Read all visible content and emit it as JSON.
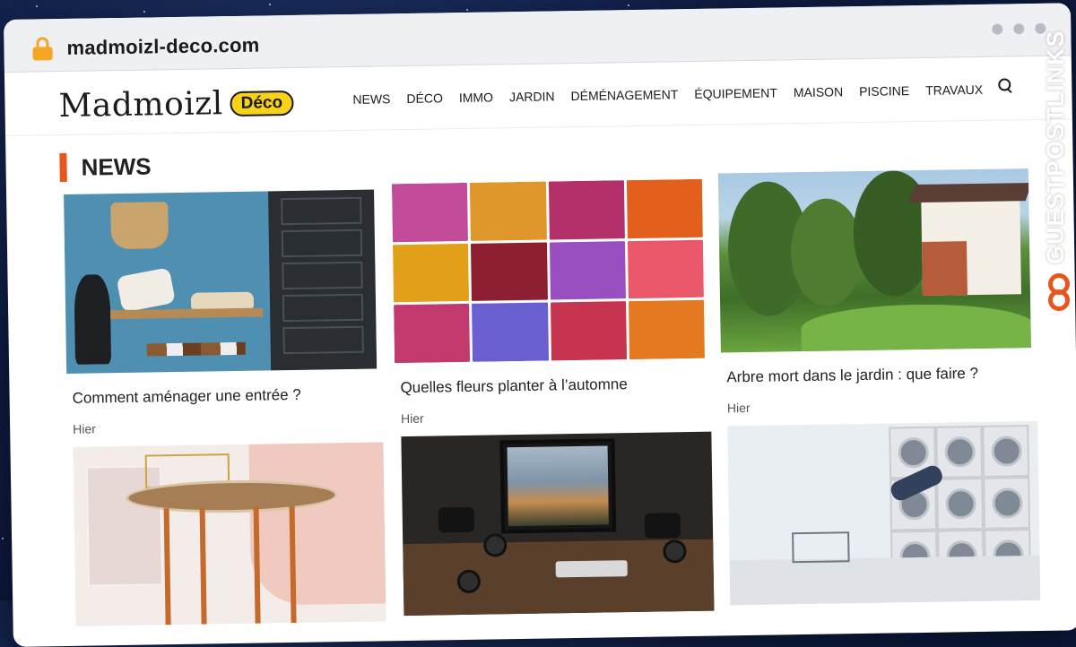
{
  "browser": {
    "url": "madmoizl-deco.com"
  },
  "site": {
    "logo_text": "Madmoizl",
    "logo_badge": "Déco",
    "nav": [
      "NEWS",
      "DÉCO",
      "IMMO",
      "JARDIN",
      "DÉMÉNAGEMENT",
      "ÉQUIPEMENT",
      "MAISON",
      "PISCINE",
      "TRAVAUX"
    ],
    "search_icon": "search-icon"
  },
  "section": {
    "title": "NEWS"
  },
  "articles": [
    {
      "title": "Comment aménager une entrée ?",
      "date": "Hier",
      "image": "entryway-bench-cabinet"
    },
    {
      "title": "Quelles fleurs planter à l’automne",
      "date": "Hier",
      "image": "autumn-flowers-collage"
    },
    {
      "title": "Arbre mort dans le jardin : que faire ?",
      "date": "Hier",
      "image": "garden-house-trees"
    },
    {
      "title": "",
      "date": "",
      "image": "wood-side-table"
    },
    {
      "title": "",
      "date": "",
      "image": "photo-desk-setup"
    },
    {
      "title": "",
      "date": "",
      "image": "laundromat-machines"
    }
  ],
  "watermark": {
    "text": "GUESTPOSTLINKS"
  },
  "colors": {
    "accent": "#e8561e",
    "badge": "#f7d21a",
    "background": "#0f1d44"
  }
}
